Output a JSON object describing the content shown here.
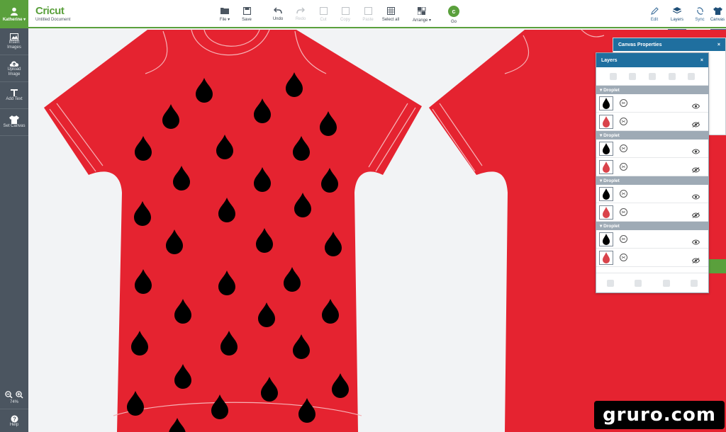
{
  "user": {
    "name": "Katherine ▾"
  },
  "app": {
    "logo": "Cricut",
    "document": "Untitled Document"
  },
  "sidebar": {
    "items": [
      {
        "label": "Insert Images",
        "icon": "image-icon"
      },
      {
        "label": "Upload Image",
        "icon": "cloud-upload-icon"
      },
      {
        "label": "Add Text",
        "icon": "text-icon"
      },
      {
        "label": "Set Canvas",
        "icon": "shirt-icon"
      }
    ],
    "zoom": "74%",
    "help": "Help"
  },
  "toolbar": {
    "file": "File ▾",
    "save": "Save",
    "undo": "Undo",
    "redo": "Redo",
    "cut": "Cut",
    "copy": "Copy",
    "paste": "Paste",
    "select_all": "Select all",
    "arrange": "Arrange ▾",
    "go": "Go",
    "edit": "Edit",
    "layers": "Layers",
    "sync": "Sync",
    "canvas": "Canvas"
  },
  "canvas_properties": {
    "title": "Canvas Properties",
    "close": "×"
  },
  "layers_panel": {
    "title": "Layers",
    "close": "×",
    "groups": [
      {
        "name": "▾ Droplet"
      },
      {
        "name": "▾ Droplet"
      },
      {
        "name": "▾ Droplet"
      },
      {
        "name": "▾ Droplet"
      }
    ]
  },
  "colors": {
    "accent": "#5aa03c",
    "panel_header": "#1f6f9f",
    "shirt": "#e52330",
    "droplet": "#000000",
    "droplet_thumb_red": "#d9434b"
  },
  "watermark": "gruro.com"
}
